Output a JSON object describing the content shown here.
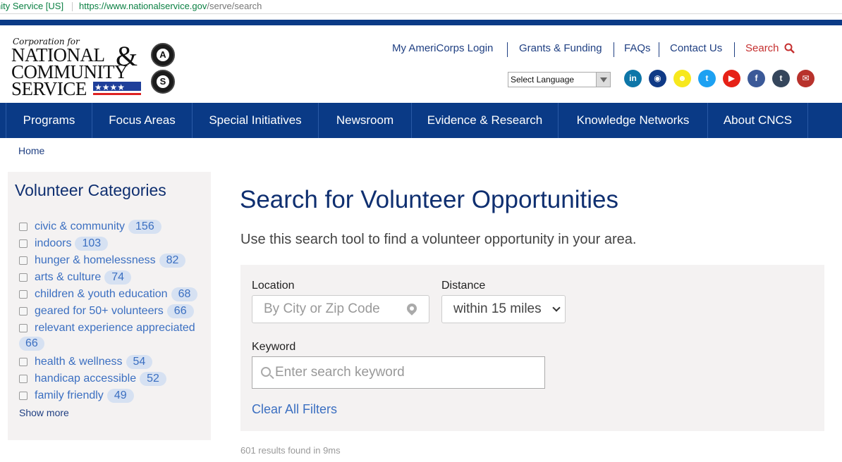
{
  "browser": {
    "site_identity": "nity Service [US]",
    "url_host": "https://www.nationalservice.gov",
    "url_path": "/serve/search"
  },
  "logo": {
    "small_text": "Corporation for",
    "line1": "NATIONAL",
    "ampersand": "&",
    "line2": "COMMUNITY",
    "line3": "SERVICE",
    "seal1_letter": "A",
    "seal2_letter": "S"
  },
  "util_nav": {
    "login": "My AmeriCorps Login",
    "grants": "Grants & Funding",
    "faqs": "FAQs",
    "contact": "Contact Us",
    "search": "Search"
  },
  "language": {
    "selected": "Select Language"
  },
  "social": [
    {
      "icon": "linkedin-icon",
      "glyph": "in",
      "color": "#0e76a8"
    },
    {
      "icon": "instagram-icon",
      "glyph": "◉",
      "color": "#0f3a86"
    },
    {
      "icon": "snapchat-icon",
      "glyph": "☻",
      "color": "#f7e81d"
    },
    {
      "icon": "twitter-icon",
      "glyph": "t",
      "color": "#1da1f2"
    },
    {
      "icon": "youtube-icon",
      "glyph": "▶",
      "color": "#e62117"
    },
    {
      "icon": "facebook-icon",
      "glyph": "f",
      "color": "#3b5998"
    },
    {
      "icon": "tumblr-icon",
      "glyph": "t",
      "color": "#35465c"
    },
    {
      "icon": "email-icon",
      "glyph": "✉",
      "color": "#b8322c"
    }
  ],
  "main_nav": [
    "Programs",
    "Focus Areas",
    "Special Initiatives",
    "Newsroom",
    "Evidence & Research",
    "Knowledge Networks",
    "About CNCS"
  ],
  "breadcrumb": {
    "home": "Home"
  },
  "sidebar": {
    "title": "Volunteer Categories",
    "categories": [
      {
        "label": "civic & community",
        "count": "156"
      },
      {
        "label": "indoors",
        "count": "103"
      },
      {
        "label": "hunger & homelessness",
        "count": "82"
      },
      {
        "label": "arts & culture",
        "count": "74"
      },
      {
        "label": "children & youth education",
        "count": "68"
      },
      {
        "label": "geared for 50+ volunteers",
        "count": "66"
      },
      {
        "label": "relevant experience appreciated",
        "count": "66"
      },
      {
        "label": "health & wellness",
        "count": "54"
      },
      {
        "label": "handicap accessible",
        "count": "52"
      },
      {
        "label": "family friendly",
        "count": "49"
      }
    ],
    "show_more": "Show more"
  },
  "main": {
    "title": "Search for Volunteer Opportunities",
    "intro": "Use this search tool to find a volunteer opportunity in your area.",
    "location_label": "Location",
    "location_placeholder": "By City or Zip Code",
    "distance_label": "Distance",
    "distance_value": "within 15 miles",
    "keyword_label": "Keyword",
    "keyword_placeholder": "Enter search keyword",
    "clear_filters": "Clear All Filters",
    "results": "601 results found in 9ms"
  },
  "colors": {
    "brand_blue": "#0a3a86",
    "link_blue": "#3b6fc1",
    "search_red": "#c53030"
  }
}
